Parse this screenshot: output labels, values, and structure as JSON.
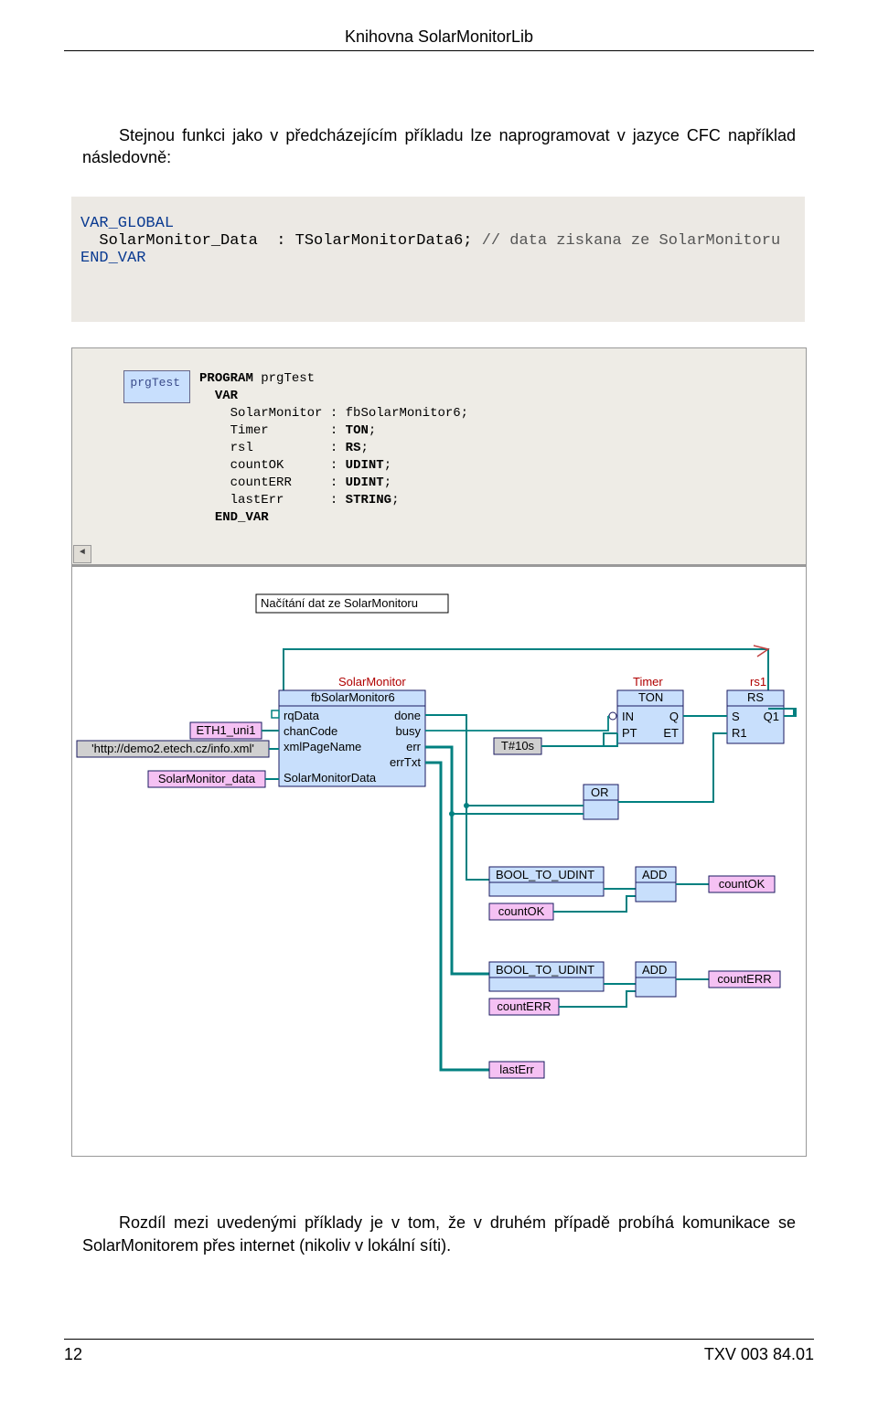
{
  "header": {
    "title": "Knihovna SolarMonitorLib"
  },
  "intro": "Stejnou funkci jako v předcházejícím příkladu lze naprogramovat v jazyce CFC například následovně:",
  "code": {
    "l1": "VAR_GLOBAL",
    "l2a": "  SolarMonitor_Data  : ",
    "l2b": "TSolarMonitorData6",
    "l2c": "; ",
    "l2d": "// data ziskana ze SolarMonitoru",
    "l3": "END_VAR"
  },
  "ide": {
    "prgTestLabel": "prgTest",
    "lines": {
      "a": "PROGRAM prgTest",
      "b": "  VAR",
      "c": "    SolarMonitor : fbSolarMonitor6;",
      "d": "    Timer        : TON;",
      "e": "    rsl          : RS;",
      "f": "    countOK      : UDINT;",
      "g": "    countERR     : UDINT;",
      "h": "    lastErr      : STRING;",
      "i": "  END_VAR"
    }
  },
  "diagram": {
    "comment": "Načítání dat ze SolarMonitoru",
    "inputs": {
      "eth": "ETH1_uni1",
      "url": "'http://demo2.etech.cz/info.xml'",
      "sm_data": "SolarMonitor_data"
    },
    "block_sm": {
      "title": "SolarMonitor",
      "type": "fbSolarMonitor6",
      "pins_left": [
        "rqData",
        "chanCode",
        "xmlPageName",
        "",
        "SolarMonitorData"
      ],
      "pins_right": [
        "done",
        "busy",
        "err",
        "errTxt",
        ""
      ]
    },
    "t10s": "T#10s",
    "timer": {
      "title": "Timer",
      "type": "TON",
      "left": [
        "IN",
        "PT"
      ],
      "right": [
        "Q",
        "ET"
      ]
    },
    "rs": {
      "title": "rs1",
      "type": "RS",
      "left": [
        "S",
        "R1"
      ],
      "right": [
        "Q1",
        ""
      ]
    },
    "or": "OR",
    "b2u": "BOOL_TO_UDINT",
    "add": "ADD",
    "countOK": "countOK",
    "countERR": "countERR",
    "lastErr": "lastErr"
  },
  "outro": "Rozdíl mezi uvedenými příklady je v tom, že v druhém případě probíhá komunikace se SolarMonitorem přes internet (nikoliv v lokální síti).",
  "footer": {
    "page": "12",
    "doc": "TXV 003 84.01"
  }
}
